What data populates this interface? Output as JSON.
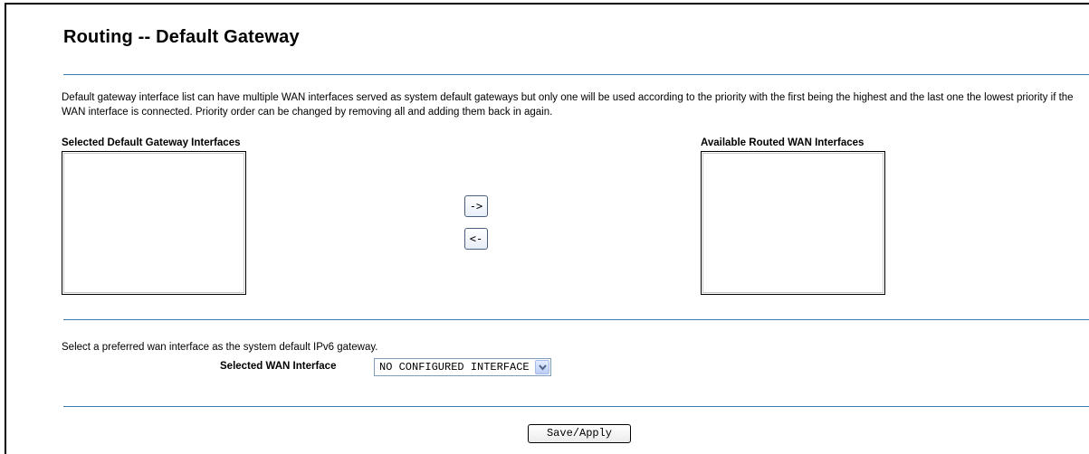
{
  "page": {
    "title": "Routing -- Default Gateway",
    "description": "Default gateway interface list can have multiple WAN interfaces served as system default gateways but only one will be used according to the priority with the first being the highest and the last one the lowest priority if the WAN interface is connected. Priority order can be changed by removing all and adding them back in again."
  },
  "lists": {
    "selected_label": "Selected Default Gateway Interfaces",
    "available_label": "Available Routed WAN Interfaces",
    "selected_items": [],
    "available_items": []
  },
  "move_buttons": {
    "add_label": "->",
    "remove_label": "<-"
  },
  "ipv6": {
    "prompt": "Select a preferred wan interface as the system default IPv6 gateway.",
    "wan_label": "Selected WAN Interface",
    "selected_value": "NO CONFIGURED INTERFACE"
  },
  "actions": {
    "save_label": "Save/Apply"
  },
  "colors": {
    "separator": "#3b7db5"
  },
  "icons": {
    "dropdown": "chevron-down-icon"
  }
}
